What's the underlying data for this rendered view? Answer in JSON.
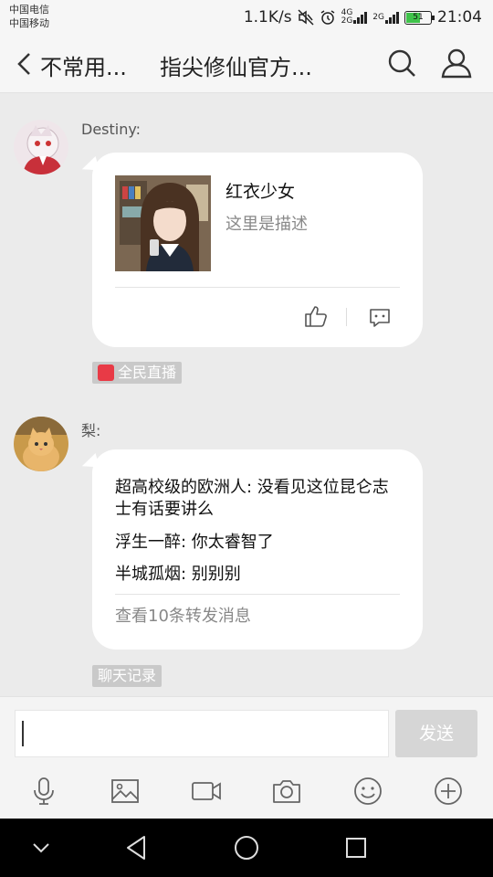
{
  "status_bar": {
    "carrier_1": "中国电信",
    "carrier_2": "中国移动",
    "net_speed": "1.1K/s",
    "signal_1": "4G",
    "signal_1b": "2G",
    "signal_2": "2G",
    "battery": "51",
    "time": "21:04"
  },
  "header": {
    "back_label": "不常用...",
    "title": "指尖修仙官方..."
  },
  "messages": [
    {
      "sender": "Destiny:",
      "card": {
        "title": "红衣少女",
        "description": "这里是描述"
      },
      "source_tag": "全民直播"
    },
    {
      "sender": "梨:",
      "forward_lines": [
        "超高校级的欧洲人: 没看见这位昆仑志士有话要讲么",
        "浮生一醉: 你太睿智了",
        "半城孤烟: 别别别"
      ],
      "more_label": "查看10条转发消息",
      "source_tag": "聊天记录"
    }
  ],
  "composer": {
    "value": "",
    "send_label": "发送"
  },
  "toolbar_icons": [
    "microphone-icon",
    "image-icon",
    "video-icon",
    "camera-icon",
    "emoji-icon",
    "plus-icon"
  ],
  "colors": {
    "background": "#ebebeb",
    "bubble": "#ffffff",
    "tag_bg": "#c9c9c9",
    "battery_fill": "#3fc24a",
    "live_logo": "#e83a46"
  }
}
